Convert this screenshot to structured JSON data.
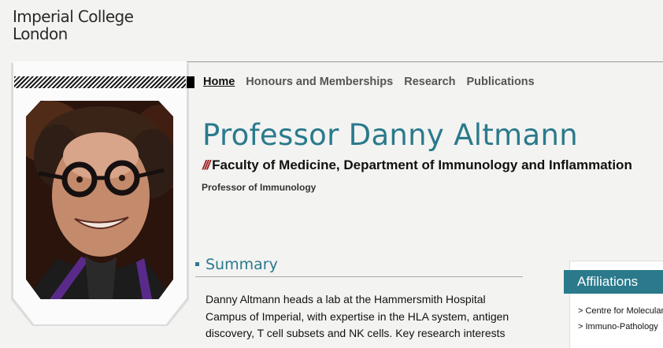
{
  "logo": {
    "line1": "Imperial College",
    "line2": "London"
  },
  "nav": {
    "items": [
      "Home",
      "Honours and Memberships",
      "Research",
      "Publications"
    ],
    "active": "Home"
  },
  "profile": {
    "name": "Professor Danny Altmann",
    "slashes": "///",
    "department": "Faculty of Medicine, Department of Immunology and Inflammation",
    "role": "Professor of Immunology"
  },
  "summary": {
    "heading": "Summary",
    "text": "Danny Altmann heads a lab at the Hammersmith Hospital Campus of Imperial, with expertise in the HLA system, antigen discovery, T cell subsets and NK cells. Key research interests"
  },
  "affiliations": {
    "heading": "Affiliations",
    "items": [
      "> Centre for Molecular Inflammation",
      "> Immuno-Pathology"
    ]
  },
  "colors": {
    "accent": "#2a7a8c",
    "slash": "#9b2226"
  }
}
